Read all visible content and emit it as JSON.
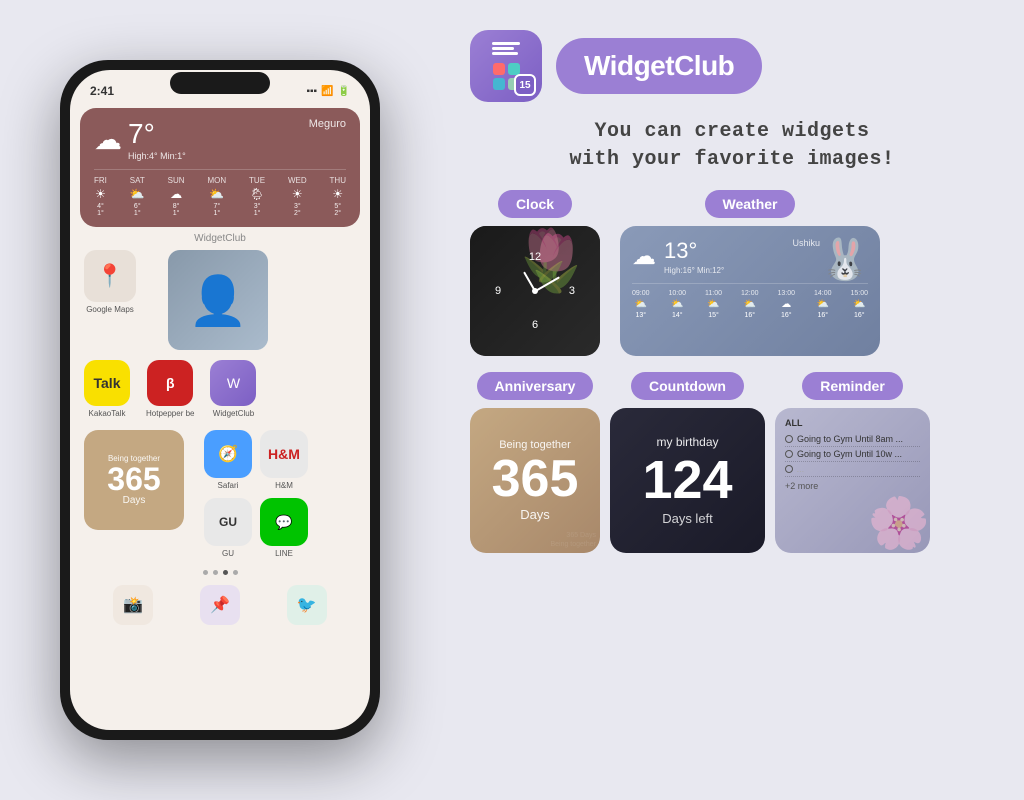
{
  "app": {
    "name": "WidgetClub",
    "tagline_line1": "You can create widgets",
    "tagline_line2": "with your favorite images!",
    "badge_number": "15"
  },
  "phone": {
    "time": "2:41",
    "weather_widget": {
      "temp": "7°",
      "location": "Meguro",
      "high_low": "High:4° Min:1°",
      "days": [
        {
          "label": "FRI",
          "icon": "☀",
          "temps": "4°\n1°"
        },
        {
          "label": "SAT",
          "icon": "⛅",
          "temps": "6°\n1°"
        },
        {
          "label": "SUN",
          "icon": "☁",
          "temps": "8°\n1°"
        },
        {
          "label": "MON",
          "icon": "⛅",
          "temps": "7°\n1°"
        },
        {
          "label": "TUE",
          "icon": "🌧",
          "temps": "3°\n1°"
        },
        {
          "label": "WED",
          "icon": "☀",
          "temps": "3°\n2°"
        },
        {
          "label": "THU",
          "icon": "☀",
          "temps": "5°\n2°"
        }
      ]
    },
    "apps": {
      "google_maps": "Google Maps",
      "kakao_talk": "KakaoTalk",
      "hotpepper": "Hotpepper be",
      "widgetclub": "WidgetClub",
      "safari": "Safari",
      "hm": "H&M",
      "gu": "GU",
      "line": "LINE"
    },
    "anniversary_widget": {
      "label": "Being together",
      "days": "365",
      "days_label": "Days"
    }
  },
  "categories": {
    "clock": {
      "label": "Clock"
    },
    "weather": {
      "label": "Weather"
    },
    "anniversary": {
      "label": "Anniversary"
    },
    "countdown": {
      "label": "Countdown"
    },
    "reminder": {
      "label": "Reminder"
    }
  },
  "weather_preview": {
    "temp": "13°",
    "location": "Ushiku",
    "high_low": "High:16° Min:12°",
    "hours": [
      {
        "time": "09:00",
        "icon": "⛅",
        "temp": "13°"
      },
      {
        "time": "10:00",
        "icon": "⛅",
        "temp": "14°"
      },
      {
        "time": "11:00",
        "icon": "⛅",
        "temp": "15°"
      },
      {
        "time": "12:00",
        "icon": "⛅",
        "temp": "16°"
      },
      {
        "time": "13:00",
        "icon": "☁",
        "temp": "16°"
      },
      {
        "time": "14:00",
        "icon": "⛅",
        "temp": "16°"
      },
      {
        "time": "15:00",
        "icon": "⛅",
        "temp": "16°"
      }
    ]
  },
  "anniversary_preview": {
    "label": "Being together",
    "days": "365",
    "days_label": "Days"
  },
  "countdown_preview": {
    "label": "my birthday",
    "days": "124",
    "days_left": "Days left"
  },
  "reminder_preview": {
    "all_label": "ALL",
    "items": [
      "Going to Gym Until 8am ...",
      "Going to Gym Until 10w ...",
      ""
    ],
    "more": "+2 more"
  }
}
